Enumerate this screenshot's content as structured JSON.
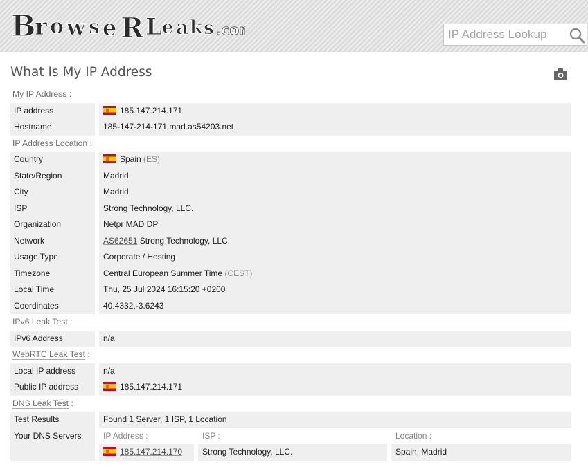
{
  "header": {
    "logo_text": "BrowserLeaks.com",
    "search_placeholder": "IP Address Lookup",
    "search_icon": "search-icon"
  },
  "page": {
    "title": "What Is My IP Address",
    "screenshot_icon": "camera-icon"
  },
  "sections": {
    "my_ip": {
      "label": "My IP Address :",
      "ip_address": {
        "key": "IP address",
        "value": "185.147.214.171",
        "flag": "es-flag"
      },
      "hostname": {
        "key": "Hostname",
        "value": "185-147-214-171.mad.as54203.net"
      }
    },
    "location": {
      "label": "IP Address Location :",
      "country": {
        "key": "Country",
        "value": "Spain",
        "suffix": "(ES)"
      },
      "state": {
        "key": "State/Region",
        "value": "Madrid"
      },
      "city": {
        "key": "City",
        "value": "Madrid"
      },
      "isp": {
        "key": "ISP",
        "value": "Strong Technology, LLC."
      },
      "organization": {
        "key": "Organization",
        "value": "Netpr MAD DP"
      },
      "network": {
        "key": "Network",
        "asn": "AS62651",
        "value": "Strong Technology, LLC."
      },
      "usage_type": {
        "key": "Usage Type",
        "value": "Corporate / Hosting"
      },
      "timezone": {
        "key": "Timezone",
        "value": "Central European Summer Time",
        "suffix": "(CEST)"
      },
      "local_time": {
        "key": "Local Time",
        "value": "Thu, 25 Jul 2024 16:15:20 +0200"
      },
      "coordinates": {
        "key": "Coordinates",
        "value": "40.4332,-3.6243"
      }
    },
    "ipv6": {
      "label": "IPv6 Leak Test :",
      "address": {
        "key": "IPv6 Address",
        "value": "n/a"
      }
    },
    "webrtc": {
      "label_link": "WebRTC Leak Test",
      "label_colon": ":",
      "local_ip": {
        "key": "Local IP address",
        "value": "n/a"
      },
      "public_ip": {
        "key": "Public IP address",
        "value": "185.147.214.171"
      }
    },
    "dns": {
      "label_link": "DNS Leak Test",
      "label_colon": ":",
      "results": {
        "key": "Test Results",
        "value": "Found 1 Server, 1 ISP, 1 Location"
      },
      "servers": {
        "key": "Your DNS Servers",
        "headers": {
          "ip": "IP Address :",
          "isp": "ISP :",
          "location": "Location :"
        },
        "rows": [
          {
            "ip": "185.147.214.170",
            "isp": "Strong Technology, LLC.",
            "location": "Spain, Madrid"
          }
        ]
      }
    }
  }
}
